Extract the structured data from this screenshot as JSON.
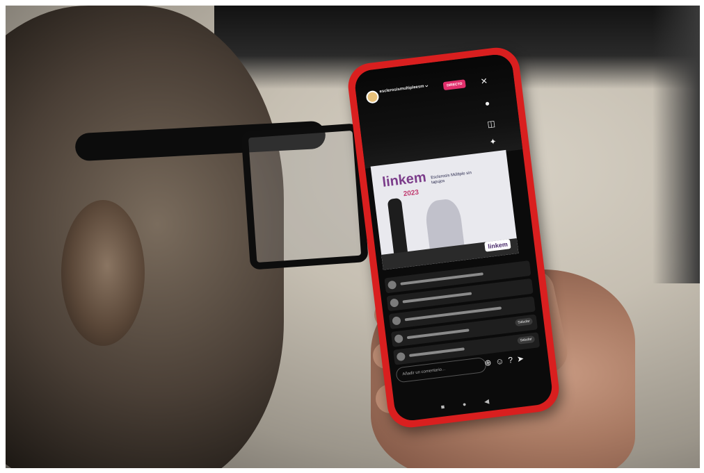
{
  "photo": {
    "subject": "person-with-glasses-holding-phone",
    "phone_case_color": "#d91f1f",
    "background_colors": [
      "#d8d2c6",
      "#9b958a"
    ]
  },
  "live_stream": {
    "username": "esclerosismultipleesm",
    "live_badge": "DIRECTO",
    "chevron_icon": "chevron-down-icon",
    "controls": [
      "close-icon",
      "mic-icon",
      "camera-flip-icon",
      "effects-icon"
    ],
    "stage": {
      "logo_text": "linkem",
      "year": "2023",
      "subtitle": "Esclerosis Múltiple sin tapujos",
      "badge_text": "linkem"
    },
    "chat_count": 5,
    "greet_label": "Saludar",
    "comment_placeholder": "Añadir un comentario...",
    "bottom_icons": [
      "add-icon",
      "people-icon",
      "question-icon",
      "send-icon"
    ]
  }
}
